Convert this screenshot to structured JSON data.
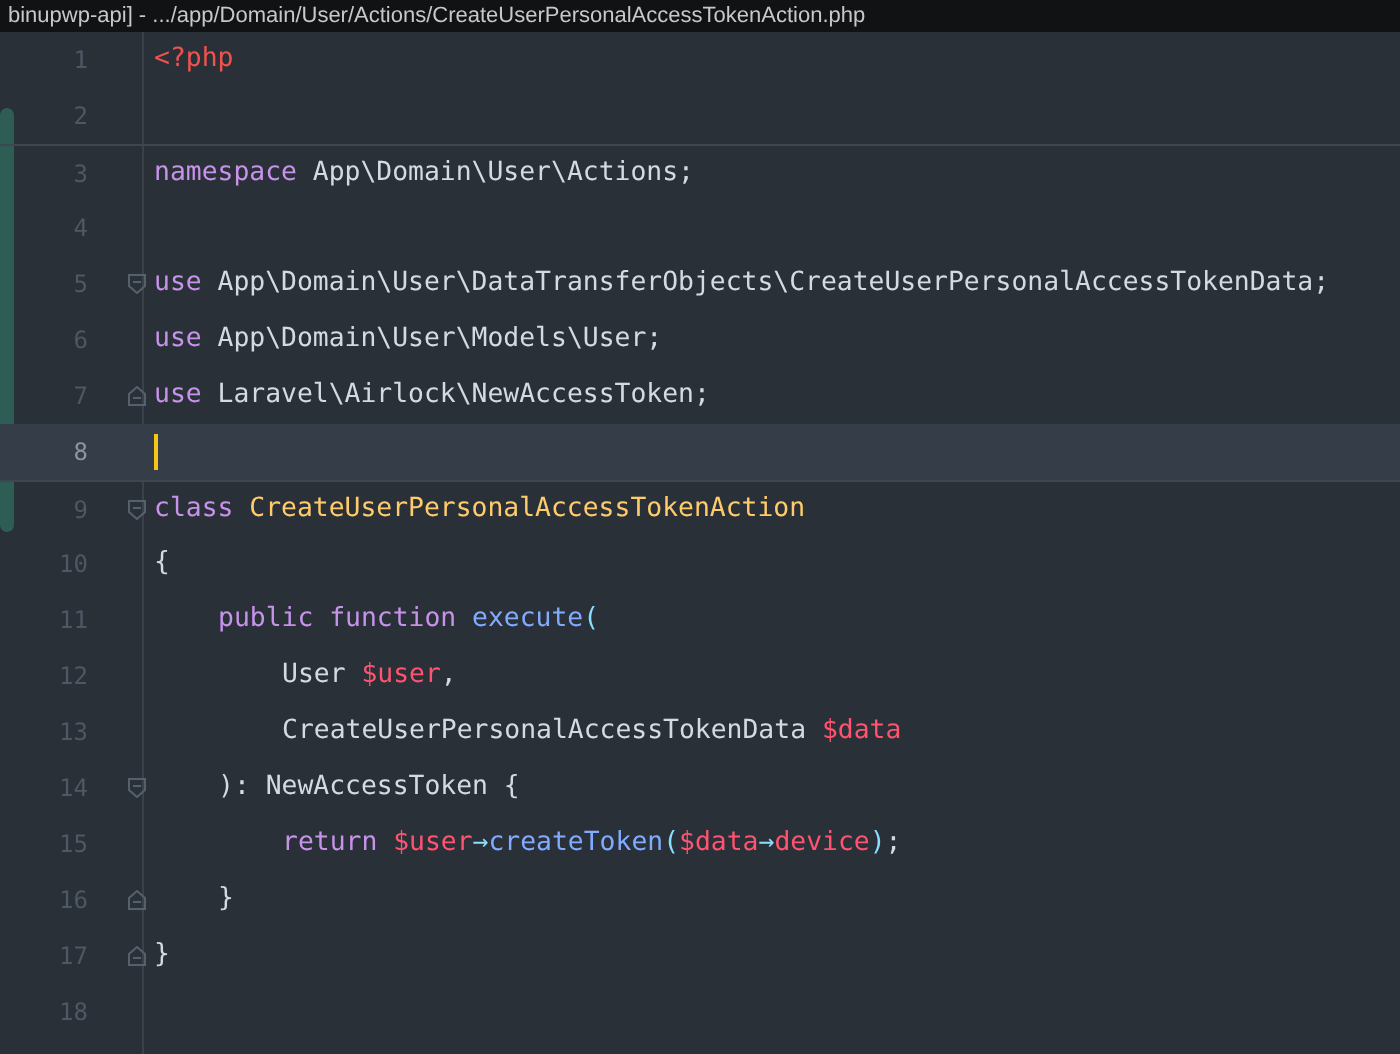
{
  "window": {
    "title": "binupwp-api] - .../app/Domain/User/Actions/CreateUserPersonalAccessTokenAction.php"
  },
  "editor": {
    "lines": [
      {
        "number": "1",
        "current": false,
        "separator_above": false,
        "fold_start": false,
        "fold_end": false,
        "tokens": [
          {
            "kind": "tag",
            "text": "<?php"
          }
        ]
      },
      {
        "number": "2",
        "current": false,
        "separator_above": false,
        "fold_start": false,
        "fold_end": false
      },
      {
        "number": "3",
        "current": false,
        "separator_above": true,
        "fold_start": false,
        "fold_end": false,
        "tokens": [
          {
            "kind": "keyword",
            "text": "namespace"
          },
          {
            "kind": "plain",
            "text": " App\\Domain\\User\\Actions;"
          }
        ]
      },
      {
        "number": "4",
        "current": false,
        "separator_above": false,
        "fold_start": false,
        "fold_end": false
      },
      {
        "number": "5",
        "current": false,
        "separator_above": false,
        "fold_start": true,
        "fold_end": false,
        "tokens": [
          {
            "kind": "keyword",
            "text": "use"
          },
          {
            "kind": "plain",
            "text": " App\\Domain\\User\\DataTransferObjects\\CreateUserPersonalAccessTokenData;"
          }
        ]
      },
      {
        "number": "6",
        "current": false,
        "separator_above": false,
        "fold_start": false,
        "fold_end": false,
        "tokens": [
          {
            "kind": "keyword",
            "text": "use"
          },
          {
            "kind": "plain",
            "text": " App\\Domain\\User\\Models\\User;"
          }
        ]
      },
      {
        "number": "7",
        "current": false,
        "separator_above": false,
        "fold_start": false,
        "fold_end": true,
        "tokens": [
          {
            "kind": "keyword",
            "text": "use"
          },
          {
            "kind": "plain",
            "text": " Laravel\\Airlock\\NewAccessToken;"
          }
        ]
      },
      {
        "number": "8",
        "current": true,
        "separator_above": false,
        "fold_start": false,
        "fold_end": false
      },
      {
        "number": "9",
        "current": false,
        "separator_above": true,
        "fold_start": true,
        "fold_end": false,
        "tokens": [
          {
            "kind": "keyword",
            "text": "class "
          },
          {
            "kind": "class",
            "text": "CreateUserPersonalAccessTokenAction"
          }
        ]
      },
      {
        "number": "10",
        "current": false,
        "separator_above": false,
        "fold_start": false,
        "fold_end": false,
        "tokens": [
          {
            "kind": "plain",
            "text": "{"
          }
        ],
        "children": [
          {
            "number": "11",
            "current": false,
            "separator_above": false,
            "fold_start": false,
            "fold_end": false,
            "tokens": [
              {
                "kind": "keyword",
                "text": "public function "
              },
              {
                "kind": "function",
                "text": "execute"
              },
              {
                "kind": "operator",
                "text": "("
              }
            ],
            "children": [
              {
                "number": "12",
                "current": false,
                "separator_above": false,
                "fold_start": false,
                "fold_end": false,
                "tokens": [
                  {
                    "kind": "plain",
                    "text": "User "
                  },
                  {
                    "kind": "variable",
                    "text": "$user"
                  },
                  {
                    "kind": "plain",
                    "text": ","
                  }
                ]
              },
              {
                "number": "13",
                "current": false,
                "separator_above": false,
                "fold_start": false,
                "fold_end": false,
                "tokens": [
                  {
                    "kind": "plain",
                    "text": "CreateUserPersonalAccessTokenData "
                  },
                  {
                    "kind": "variable",
                    "text": "$data"
                  }
                ]
              }
            ]
          },
          {
            "number": "14",
            "current": false,
            "separator_above": false,
            "fold_start": true,
            "fold_end": false,
            "tokens": [
              {
                "kind": "plain",
                "text": "): NewAccessToken {"
              }
            ],
            "children": [
              {
                "number": "15",
                "current": false,
                "separator_above": false,
                "fold_start": false,
                "fold_end": false,
                "tokens": [
                  {
                    "kind": "keyword",
                    "text": "return "
                  },
                  {
                    "kind": "variable",
                    "text": "$user"
                  },
                  {
                    "kind": "operator",
                    "text": "→"
                  },
                  {
                    "kind": "function",
                    "text": "createToken"
                  },
                  {
                    "kind": "operator",
                    "text": "("
                  },
                  {
                    "kind": "variable",
                    "text": "$data"
                  },
                  {
                    "kind": "operator",
                    "text": "→"
                  },
                  {
                    "kind": "variable",
                    "text": "device"
                  },
                  {
                    "kind": "operator",
                    "text": ")"
                  },
                  {
                    "kind": "plain",
                    "text": ";"
                  }
                ]
              }
            ]
          },
          {
            "number": "16",
            "current": false,
            "separator_above": false,
            "fold_start": false,
            "fold_end": true,
            "tokens": [
              {
                "kind": "plain",
                "text": "}"
              }
            ]
          }
        ]
      },
      {
        "number": "17",
        "current": false,
        "separator_above": false,
        "fold_start": false,
        "fold_end": true,
        "tokens": [
          {
            "kind": "plain",
            "text": "}"
          }
        ]
      },
      {
        "number": "18",
        "current": false,
        "separator_above": false,
        "fold_start": false,
        "fold_end": false
      }
    ]
  }
}
